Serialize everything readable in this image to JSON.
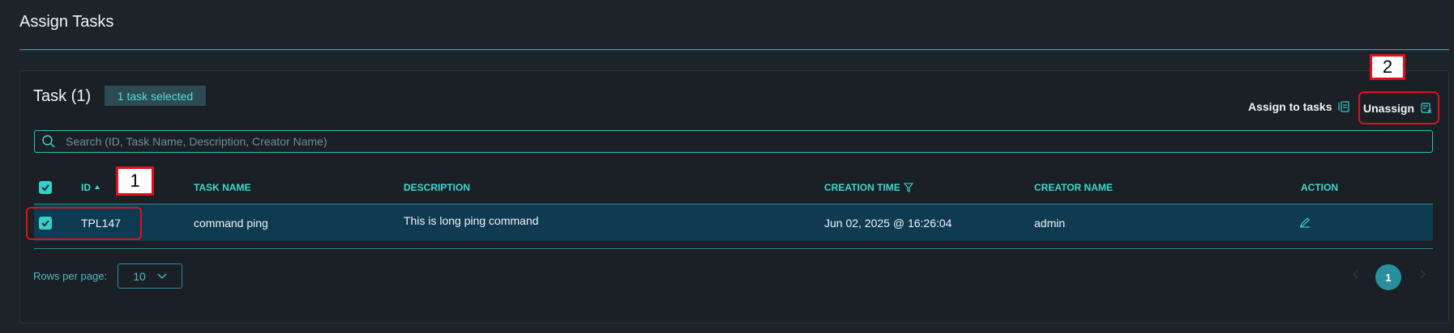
{
  "page": {
    "title": "Assign Tasks"
  },
  "task_panel": {
    "heading": "Task (1)",
    "selected_badge": "1 task selected",
    "assign_label": "Assign to tasks",
    "unassign_label": "Unassign"
  },
  "markers": {
    "one": "1",
    "two": "2"
  },
  "search": {
    "placeholder": "Search (ID, Task Name, Description, Creator Name)",
    "value": ""
  },
  "table": {
    "columns": [
      "ID",
      "TASK NAME",
      "DESCRIPTION",
      "CREATION TIME",
      "CREATOR NAME",
      "ACTION"
    ],
    "rows": [
      {
        "selected": true,
        "id": "TPL147",
        "task_name": "command ping",
        "description": "This is long ping command",
        "creation_time": "Jun 02, 2025 @ 16:26:04",
        "creator_name": "admin"
      }
    ]
  },
  "pagination": {
    "rows_per_page_label": "Rows per page:",
    "rows_per_page_value": "10",
    "current_page": "1"
  },
  "icons": {
    "assign": "assign-list-icon",
    "unassign": "unassign-list-icon",
    "sort": "sort-asc-icon",
    "filter": "filter-icon",
    "edit": "pencil-icon",
    "search": "search-icon",
    "chevron": "chevron-down-icon"
  },
  "colors": {
    "accent": "#37cfc9",
    "row_selected": "#0e3a52",
    "highlight": "#e0101a"
  }
}
